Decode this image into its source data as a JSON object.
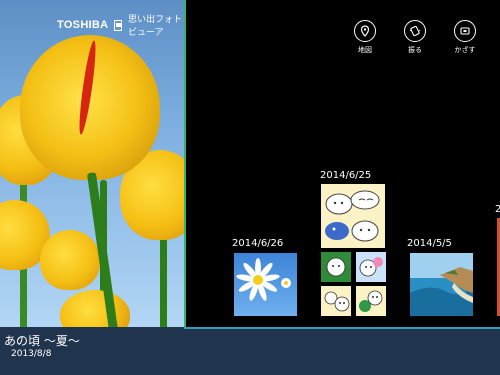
{
  "brand": {
    "company": "TOSHIBA",
    "app_name": "思い出フォトビューア"
  },
  "actions": [
    {
      "label": "地図",
      "icon": "map-icon"
    },
    {
      "label": "振る",
      "icon": "shake-icon"
    },
    {
      "label": "かざす",
      "icon": "hold-up-icon"
    }
  ],
  "album": {
    "title": "あの頃 ～夏～",
    "date": "2013/8/8"
  },
  "groups": [
    {
      "date": "2014/6/26"
    },
    {
      "date": "2014/6/25"
    },
    {
      "date": "2014/5/5"
    },
    {
      "date": "2"
    }
  ],
  "colors": {
    "divider": "#35b46a",
    "title_bar": "#20344d",
    "accent_line": "#33a0b8"
  }
}
